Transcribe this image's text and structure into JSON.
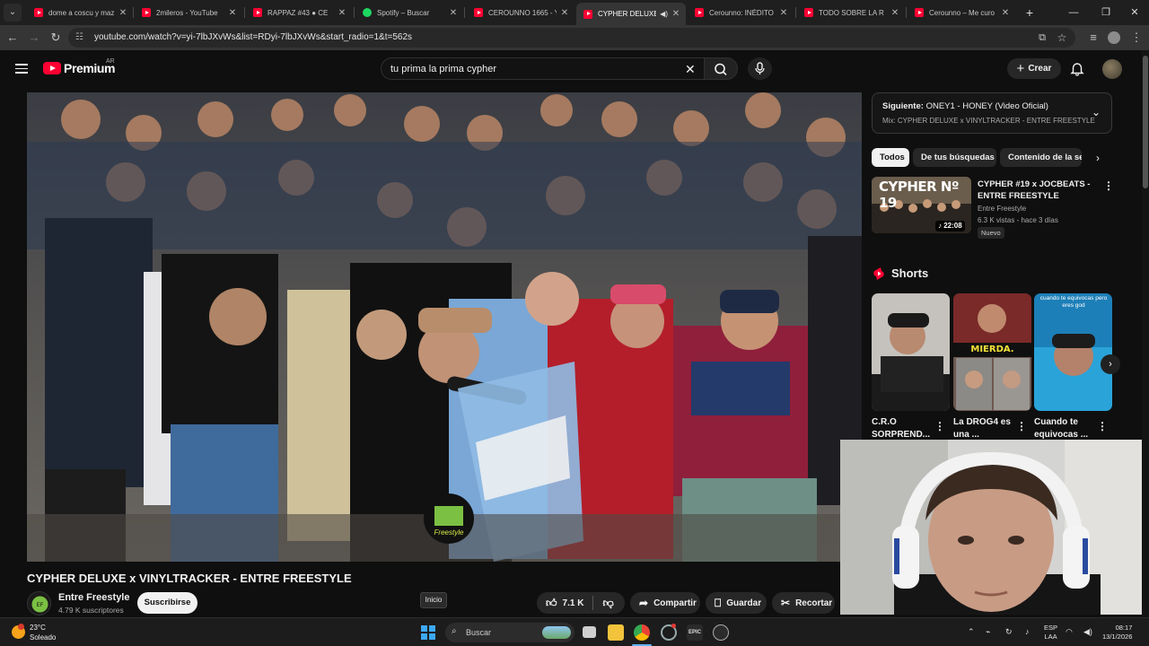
{
  "browser": {
    "tabs": [
      {
        "title": "dome a coscu y maz",
        "icon": "youtube-icon"
      },
      {
        "title": "2mileros - YouTube",
        "icon": "youtube-icon"
      },
      {
        "title": "RAPPAZ #43 ● CE",
        "icon": "youtube-icon"
      },
      {
        "title": "Spotify – Buscar",
        "icon": "spotify-icon"
      },
      {
        "title": "CEROUNNO 1665 - Y",
        "icon": "youtube-icon"
      },
      {
        "title": "CYPHER DELUXE",
        "icon": "youtube-icon",
        "active": true,
        "audio": true
      },
      {
        "title": "Cerounno: INÉDITO D",
        "icon": "youtube-icon"
      },
      {
        "title": "TODO SOBRE LA R",
        "icon": "youtube-icon"
      },
      {
        "title": "Cerounno – Me curo",
        "icon": "youtube-icon"
      }
    ],
    "url": "youtube.com/watch?v=yi-7lbJXvWs&list=RDyi-7lbJXvWs&start_radio=1&t=562s"
  },
  "youtube": {
    "logo": "Premium",
    "region": "AR",
    "search_value": "tu prima la prima cypher",
    "create_label": "Crear"
  },
  "video": {
    "title": "CYPHER DELUXE x VINYLTRACKER - ENTRE FREESTYLE",
    "channel": "Entre Freestyle",
    "subscribers": "4.79 K suscriptores",
    "subscribe_label": "Suscribirse",
    "likes": "7.1 K",
    "share_label": "Compartir",
    "save_label": "Guardar",
    "clip_label": "Recortar",
    "tooltip": "Inicio"
  },
  "sidebar": {
    "next_prefix": "Siguiente:",
    "next_title": "ONEY1 - HONEY (Video Oficial)",
    "mix": "Mix: CYPHER DELUXE x VINYLTRACKER - ENTRE FREESTYLE",
    "chips": [
      "Todos",
      "De tus búsquedas",
      "Contenido de la ser"
    ],
    "rec": {
      "thumb_text": "CYPHER Nº 19",
      "duration": "22:08",
      "title": "CYPHER #19 x JOCBEATS - ENTRE FREESTYLE",
      "channel": "Entre Freestyle",
      "meta": "6.3 K vistas - hace 3 días",
      "badge": "Nuevo"
    },
    "shorts_label": "Shorts",
    "shorts": [
      {
        "title": "C.R.O SORPREND..."
      },
      {
        "title": "La DROG4 es una ...",
        "overlay": "MIERDA."
      },
      {
        "title": "Cuando te equivocas ...",
        "overlay": "cuando te equivocas pero eres god"
      }
    ]
  },
  "taskbar": {
    "temp": "23°C",
    "weather": "Soleado",
    "search": "Buscar",
    "lang1": "ESP",
    "lang2": "LAA",
    "time": "08:17",
    "date": "13/1/2026"
  }
}
